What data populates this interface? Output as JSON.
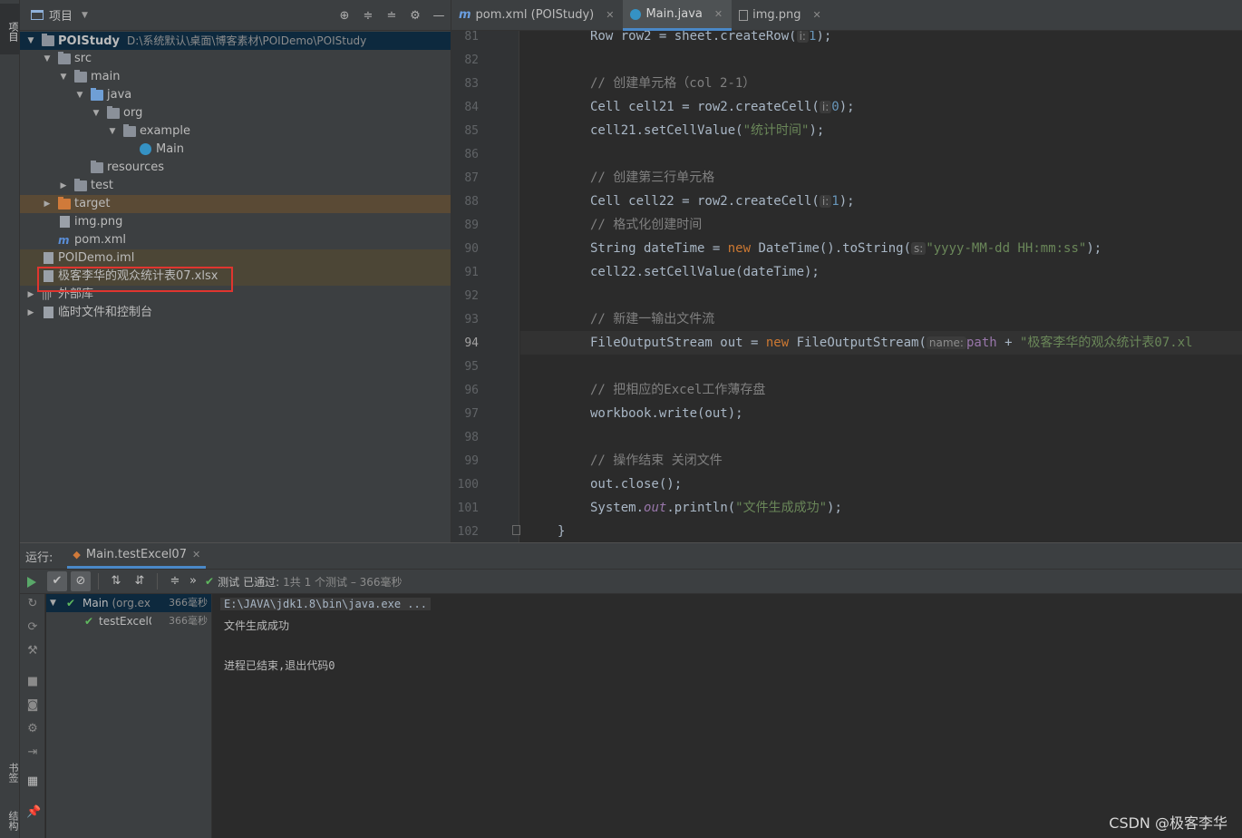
{
  "left_strip": {
    "project_tab": "项目",
    "bookmarks_tab": "书签",
    "structure_tab": "结构"
  },
  "project_panel": {
    "title": "项目",
    "tree": [
      {
        "label": "POIStudy",
        "hint": "D:\\系统默认\\桌面\\博客素材\\POIDemo\\POIStudy"
      },
      {
        "label": "src"
      },
      {
        "label": "main"
      },
      {
        "label": "java"
      },
      {
        "label": "org"
      },
      {
        "label": "example"
      },
      {
        "label": "Main"
      },
      {
        "label": "resources"
      },
      {
        "label": "test"
      },
      {
        "label": "target"
      },
      {
        "label": "img.png"
      },
      {
        "label": "pom.xml"
      },
      {
        "label": "POIDemo.iml"
      },
      {
        "label": "极客李华的观众统计表07.xlsx"
      },
      {
        "label": "外部库"
      },
      {
        "label": "临时文件和控制台"
      }
    ]
  },
  "editor": {
    "tabs": [
      {
        "label": "pom.xml (POIStudy)",
        "icon": "maven-icon"
      },
      {
        "label": "Main.java",
        "icon": "java-class-icon",
        "active": true
      },
      {
        "label": "img.png",
        "icon": "image-file-icon"
      }
    ],
    "line_numbers": [
      "81",
      "82",
      "83",
      "84",
      "85",
      "86",
      "87",
      "88",
      "89",
      "90",
      "91",
      "92",
      "93",
      "94",
      "95",
      "96",
      "97",
      "98",
      "99",
      "100",
      "101",
      "102"
    ],
    "current_line": "94",
    "code": {
      "l81_a": "Row row2 = sheet.createRow(",
      "l81_hint": "i:",
      "l81_b": "1",
      "l81_c": ");",
      "l83": "// 创建单元格（col 2-1）",
      "l84_a": "Cell cell21 = row2.createCell(",
      "l84_hint": "i:",
      "l84_b": "0",
      "l84_c": ");",
      "l85_a": "cell21.setCellValue(",
      "l85_s": "\"统计时间\"",
      "l85_c": ");",
      "l87": "// 创建第三行单元格",
      "l88_a": "Cell cell22 = row2.createCell(",
      "l88_hint": "i:",
      "l88_b": "1",
      "l88_c": ");",
      "l89": "// 格式化创建时间",
      "l90_a": "String dateTime = ",
      "l90_new": "new",
      "l90_b": " DateTime().toString(",
      "l90_hint": "s:",
      "l90_s": "\"yyyy-MM-dd HH:mm:ss\"",
      "l90_c": ");",
      "l91": "cell22.setCellValue(dateTime);",
      "l93": "// 新建一输出文件流",
      "l94_a": "FileOutputStream out = ",
      "l94_new": "new",
      "l94_b": " FileOutputStream(",
      "l94_hint": "name:",
      "l94_path": "path",
      "l94_plus": " + ",
      "l94_s": "\"极客李华的观众统计表07.xl",
      "l96": "// 把相应的Excel工作薄存盘",
      "l97": "workbook.write(out);",
      "l99": "// 操作结束 关闭文件",
      "l100": "out.close();",
      "l101_a": "System.",
      "l101_out": "out",
      "l101_b": ".println(",
      "l101_s": "\"文件生成成功\"",
      "l101_c": ");",
      "l102": "}"
    }
  },
  "run_panel": {
    "label": "运行:",
    "tab": "Main.testExcel07",
    "status_test": "测试",
    "status_passed": "已通过:",
    "status_count": "1共 1 个测试 – 366毫秒",
    "tree": [
      {
        "label": "Main",
        "sub": "(org.ex",
        "time": "366毫秒"
      },
      {
        "label": "testExcel0",
        "time": "366毫秒"
      }
    ],
    "console": [
      "E:\\JAVA\\jdk1.8\\bin\\java.exe ...",
      "文件生成成功",
      "",
      "进程已结束,退出代码0"
    ]
  },
  "watermark": "CSDN @极客李华"
}
